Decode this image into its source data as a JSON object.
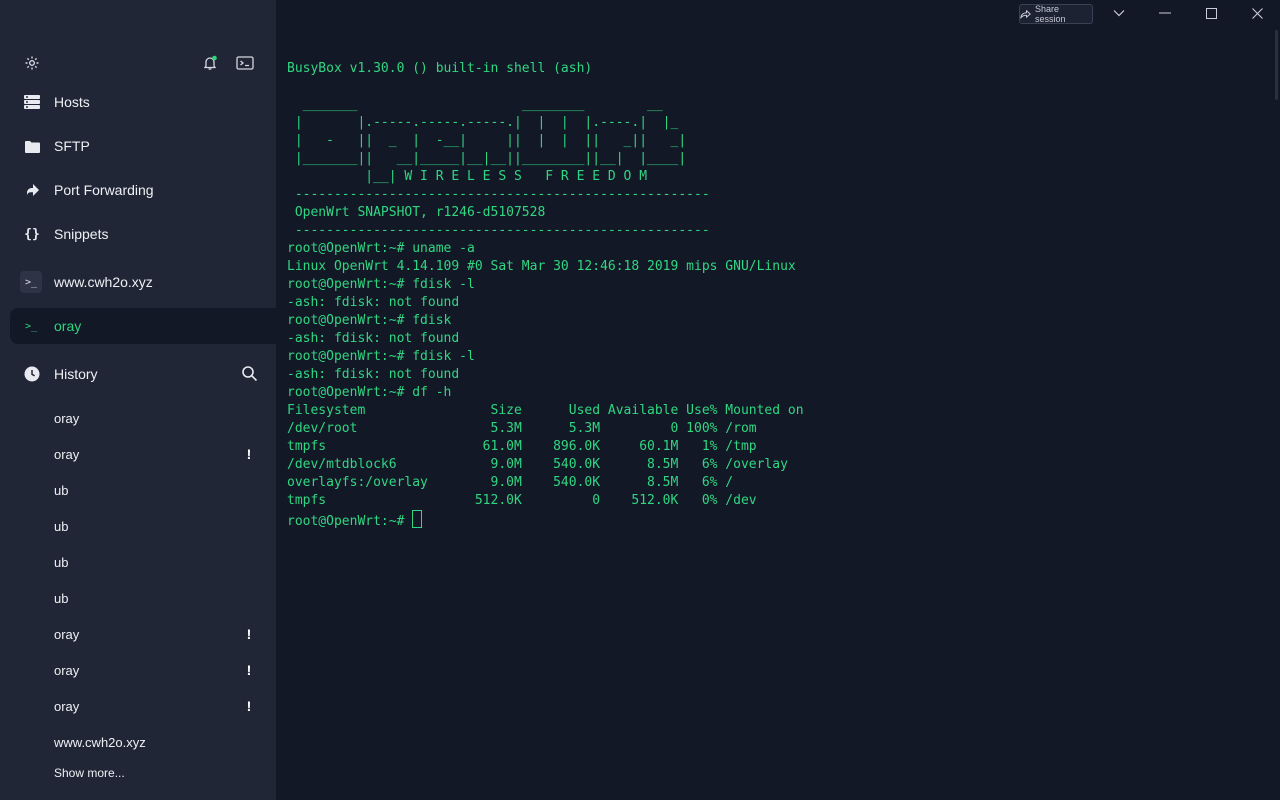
{
  "sidebar": {
    "nav": [
      {
        "label": "Hosts",
        "icon": "hosts-icon"
      },
      {
        "label": "SFTP",
        "icon": "folder-icon"
      },
      {
        "label": "Port Forwarding",
        "icon": "port-forwarding-icon"
      },
      {
        "label": "Snippets",
        "icon": "snippets-icon"
      }
    ],
    "tabs": [
      {
        "label": "www.cwh2o.xyz",
        "active": false
      },
      {
        "label": "oray",
        "active": true
      }
    ],
    "history": {
      "title": "History",
      "items": [
        {
          "label": "oray",
          "warn": false
        },
        {
          "label": "oray",
          "warn": true
        },
        {
          "label": "ub",
          "warn": false
        },
        {
          "label": "ub",
          "warn": false
        },
        {
          "label": "ub",
          "warn": false
        },
        {
          "label": "ub",
          "warn": false
        },
        {
          "label": "oray",
          "warn": true
        },
        {
          "label": "oray",
          "warn": true
        },
        {
          "label": "oray",
          "warn": true
        },
        {
          "label": "www.cwh2o.xyz",
          "warn": false
        }
      ],
      "show_more": "Show more...",
      "warn_glyph": "!"
    }
  },
  "titlebar": {
    "share_label": "Share session"
  },
  "terminal": {
    "accent": "#30d682",
    "lines": [
      "BusyBox v1.30.0 () built-in shell (ash)",
      "",
      "  _______                     ________        __",
      " |       |.-----.-----.-----.|  |  |  |.----.|  |_",
      " |   -   ||  _  |  -__|     ||  |  |  ||   _||   _|",
      " |_______||   __|_____|__|__||________||__|  |____|",
      "          |__| W I R E L E S S   F R E E D O M",
      " -----------------------------------------------------",
      " OpenWrt SNAPSHOT, r1246-d5107528",
      " -----------------------------------------------------",
      "root@OpenWrt:~# uname -a",
      "Linux OpenWrt 4.14.109 #0 Sat Mar 30 12:46:18 2019 mips GNU/Linux",
      "root@OpenWrt:~# fdisk -l",
      "-ash: fdisk: not found",
      "root@OpenWrt:~# fdisk",
      "-ash: fdisk: not found",
      "root@OpenWrt:~# fdisk -l",
      "-ash: fdisk: not found",
      "root@OpenWrt:~# df -h",
      "Filesystem                Size      Used Available Use% Mounted on",
      "/dev/root                 5.3M      5.3M         0 100% /rom",
      "tmpfs                    61.0M    896.0K     60.1M   1% /tmp",
      "/dev/mtdblock6            9.0M    540.0K      8.5M   6% /overlay",
      "overlayfs:/overlay        9.0M    540.0K      8.5M   6% /",
      "tmpfs                   512.0K         0    512.0K   0% /dev"
    ],
    "prompt": "root@OpenWrt:~# "
  }
}
